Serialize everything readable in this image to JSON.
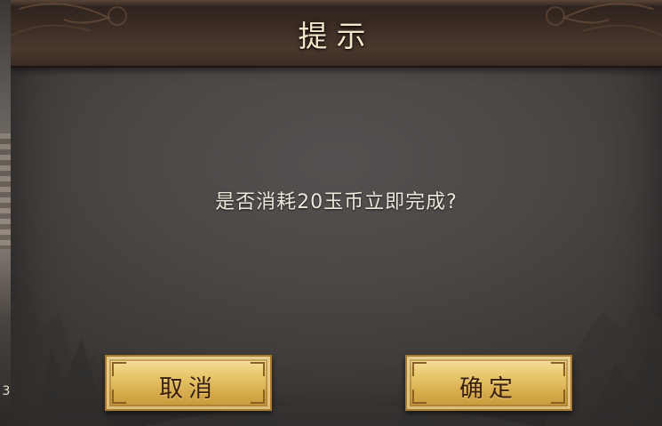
{
  "dialog": {
    "title": "提示",
    "message": "是否消耗20玉币立即完成?"
  },
  "buttons": {
    "cancel_label": "取消",
    "confirm_label": "确定"
  },
  "background": {
    "edge_glyph": "3"
  },
  "colors": {
    "header": "#3b2c24",
    "panel": "#4a4745",
    "title_text": "#f2e6c9",
    "message_text": "#ece6da",
    "button_gold": "#e8c86e",
    "button_text": "#3a1f0e"
  },
  "icons": {
    "header_ornament": "swirl-ornament-icon"
  }
}
